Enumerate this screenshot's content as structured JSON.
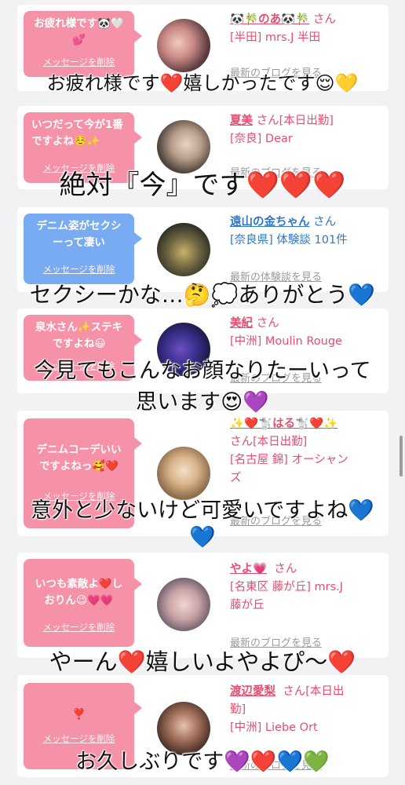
{
  "items": [
    {
      "message": "お疲れ様です🐼🤍💕",
      "delete_label": "メッセージを削除",
      "name": "🐼🎋のあ🐼🎋",
      "san": "さん",
      "shop_line1": "[半田] mrs.J 半田",
      "shop_line2": "",
      "more_label": "最新のブログを見る",
      "bubble_color": "pink",
      "info_color": "pink"
    },
    {
      "message": "いつだって今が1番ですよね☺️✨",
      "delete_label": "メッセージを削除",
      "name": "夏美",
      "san": "さん[本日出勤]",
      "shop_line1": "[奈良] Dear",
      "shop_line2": "",
      "more_label": "最新のブログを見る",
      "bubble_color": "pink",
      "info_color": "pink"
    },
    {
      "message": "デニム姿がセクシーって凄い",
      "delete_label": "メッセージを削除",
      "name": "遠山の金ちゃん",
      "san": "さん",
      "shop_line1": "[奈良県] 体験談 101件",
      "shop_line2": "",
      "more_label": "最新の体験談を見る",
      "bubble_color": "blue",
      "info_color": "blue"
    },
    {
      "message": "泉水さん✨ステキですよね😀",
      "delete_label": "メッセージを削除",
      "name": "美紀",
      "san": "さん",
      "shop_line1": "[中洲] Moulin Rouge",
      "shop_line2": "",
      "more_label": "最新のブログを見る",
      "bubble_color": "pink",
      "info_color": "pink"
    },
    {
      "message": "デニムコーデいいですよねっ🥰❤️",
      "delete_label": "メッセージを削除",
      "name": "✨❤️🐩はる🐩❤️✨",
      "san": "さん[本日出勤]",
      "shop_line1": "[名古屋 錦] オーシャン",
      "shop_line2": "ズ",
      "more_label": "最新のブログを見る",
      "bubble_color": "pink",
      "info_color": "pink"
    },
    {
      "message": "いつも素敵よ❤️しおりん😉💗💗",
      "delete_label": "メッセージを削除",
      "name": "やよ💗",
      "san": "さん",
      "shop_line1": "[名東区 藤が丘] mrs.J",
      "shop_line2": "藤が丘",
      "more_label": "最新のブログを見る",
      "bubble_color": "pink",
      "info_color": "pink"
    },
    {
      "message": "❣️",
      "delete_label": "メッセージを削除",
      "name": "渡辺愛梨",
      "san": "さん[本日出",
      "shop_line1": "勤]",
      "shop_line2": "[中洲] Liebe Ort",
      "more_label": "最新のブログを見る",
      "bubble_color": "pink",
      "info_color": "pink"
    }
  ],
  "overlays": [
    "お疲れ様です❤️嬉しかったです😌💛",
    "絶対『今』です❤️❤️❤️",
    "セクシーかな…🤔💭ありがとう💙",
    "今見てもこんなお顔なりたーいって",
    "思います😍💜",
    "意外と少ないけど可愛いですよね💙",
    "💙",
    "やーん❤️嬉しいよやよぴ〜❤️",
    "お久しぶりです💜❤️💙💚"
  ],
  "colors": {
    "pink_bubble": "#f592a7",
    "blue_bubble": "#79abf2",
    "name_pink": "#e64d6e",
    "name_blue": "#2f77c8"
  }
}
